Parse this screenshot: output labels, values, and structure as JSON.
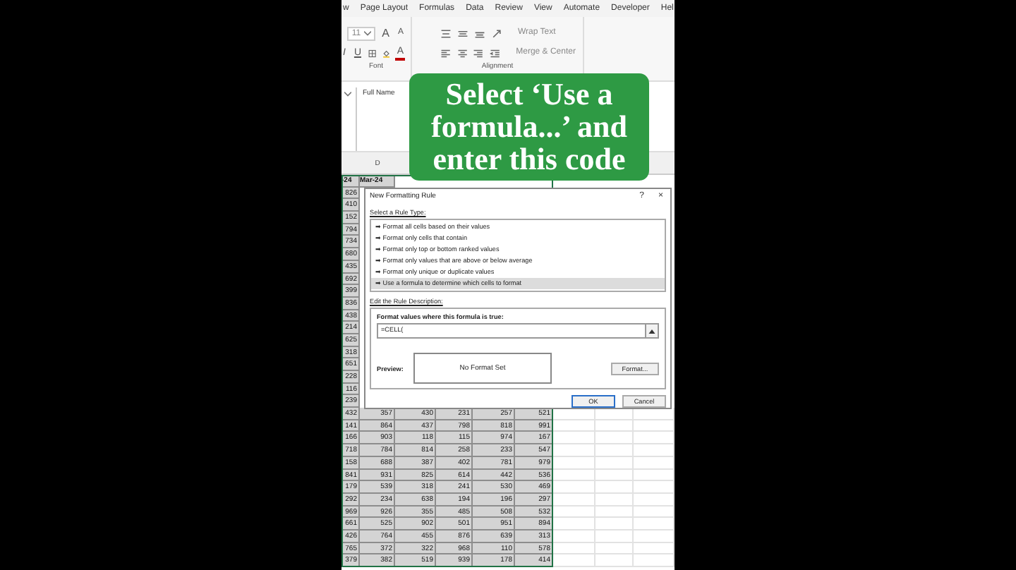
{
  "ribbon_tabs": [
    "w",
    "Page Layout",
    "Formulas",
    "Data",
    "Review",
    "View",
    "Automate",
    "Developer",
    "Hel"
  ],
  "font_group": {
    "font_size": "11",
    "grow": "A",
    "shrink": "A",
    "italic": "I",
    "underline": "U",
    "font_color": "A",
    "label": "Font"
  },
  "alignment_group": {
    "wrap_text": "Wrap Text",
    "merge": "Merge & Center",
    "label": "Alignment"
  },
  "formula_bar": {
    "value": "Full Name"
  },
  "column_header": "D",
  "caption": "Select ‘Use a formula...’ and enter this code",
  "sheet": {
    "header": [
      "-24",
      "Mar-24"
    ],
    "left_column": [
      "826",
      "410",
      "152",
      "794",
      "734",
      "680",
      "435",
      "692",
      "399",
      "836",
      "438",
      "214",
      "625",
      "318",
      "651",
      "228",
      "116",
      "239"
    ],
    "rows": [
      [
        "432",
        "357",
        "430",
        "231",
        "257",
        "521"
      ],
      [
        "141",
        "864",
        "437",
        "798",
        "818",
        "991"
      ],
      [
        "166",
        "903",
        "118",
        "115",
        "974",
        "167"
      ],
      [
        "718",
        "784",
        "814",
        "258",
        "233",
        "547"
      ],
      [
        "158",
        "688",
        "387",
        "402",
        "781",
        "979"
      ],
      [
        "841",
        "931",
        "825",
        "614",
        "442",
        "536"
      ],
      [
        "179",
        "539",
        "318",
        "241",
        "530",
        "469"
      ],
      [
        "292",
        "234",
        "638",
        "194",
        "196",
        "297"
      ],
      [
        "969",
        "926",
        "355",
        "485",
        "508",
        "532"
      ],
      [
        "661",
        "525",
        "902",
        "501",
        "951",
        "894"
      ],
      [
        "426",
        "764",
        "455",
        "876",
        "639",
        "313"
      ],
      [
        "765",
        "372",
        "322",
        "968",
        "110",
        "578"
      ],
      [
        "379",
        "382",
        "519",
        "939",
        "178",
        "414"
      ]
    ]
  },
  "dialog": {
    "title": "New Formatting Rule",
    "help": "?",
    "close": "×",
    "rule_type_label": "Select a Rule Type:",
    "rule_types": [
      {
        "label": "➡ Format all cells based on their values",
        "selected": false
      },
      {
        "label": "➡ Format only cells that contain",
        "selected": false
      },
      {
        "label": "➡ Format only top or bottom ranked values",
        "selected": false
      },
      {
        "label": "➡ Format only values that are above or below average",
        "selected": false
      },
      {
        "label": "➡ Format only unique or duplicate values",
        "selected": false
      },
      {
        "label": "➡ Use a formula to determine which cells to format",
        "selected": true
      }
    ],
    "description_label": "Edit the Rule Description:",
    "formula_label": "Format values where this formula is true:",
    "formula_value": "=CELL(",
    "preview_label": "Preview:",
    "preview_text": "No Format Set",
    "format_button": "Format...",
    "ok": "OK",
    "cancel": "Cancel"
  }
}
